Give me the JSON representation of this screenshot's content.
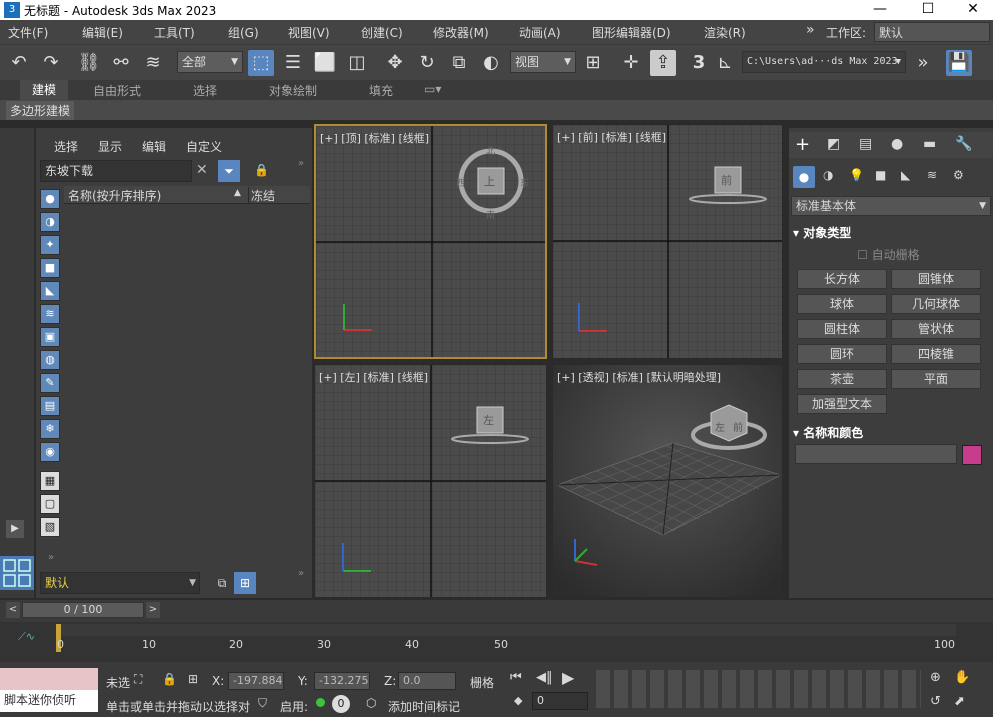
{
  "window": {
    "title": "无标题 - Autodesk 3ds Max 2023",
    "app_icon": "3",
    "minimize": "—",
    "maximize": "☐",
    "close": "✕"
  },
  "menu": [
    "文件(F)",
    "编辑(E)",
    "工具(T)",
    "组(G)",
    "视图(V)",
    "创建(C)",
    "修改器(M)",
    "动画(A)",
    "图形编辑器(D)",
    "渲染(R)"
  ],
  "menu_right": {
    "expand": "»",
    "workspace_label": "工作区:",
    "workspace_value": "默认"
  },
  "toolbar": {
    "selection_filter": "全部",
    "ref_coord": "视图",
    "path": "C:\\Users\\ad···ds Max 2023",
    "snap_value": "3",
    "expand": "»"
  },
  "ribbon": {
    "tabs": [
      "建模",
      "自由形式",
      "选择",
      "对象绘制",
      "填充"
    ],
    "sub_label": "多边形建模"
  },
  "explorer": {
    "menus": [
      "选择",
      "显示",
      "编辑",
      "自定义"
    ],
    "search_value": "东坡下载",
    "col_name": "名称(按升序排序)",
    "col_sort": "▲",
    "col_frozen": "冻结",
    "layer": "默认",
    "expand": "»"
  },
  "viewports": {
    "top": "[+] [顶] [标准] [线框]",
    "front": "[+] [前] [标准] [线框]",
    "left": "[+] [左] [标准] [线框]",
    "persp": "[+] [透视] [标准] [默认明暗处理]",
    "cube_top": "上",
    "cube_front": "前",
    "cube_left": "左",
    "cube_persp_a": "左",
    "cube_persp_b": "前",
    "compass_n": "北",
    "compass_s": "南",
    "compass_w": "西",
    "compass_e": "东"
  },
  "command_panel": {
    "category": "标准基本体",
    "object_type_title": "对象类型",
    "autogrid": "自动栅格",
    "buttons": [
      "长方体",
      "圆锥体",
      "球体",
      "几何球体",
      "圆柱体",
      "管状体",
      "圆环",
      "四棱锥",
      "茶壶",
      "平面",
      "加强型文本"
    ],
    "name_color_title": "名称和颜色",
    "object_color": "#c83c8c"
  },
  "timeline": {
    "frame_display": "0 / 100",
    "ticks": [
      "0",
      "10",
      "20",
      "30",
      "40",
      "50",
      "100"
    ],
    "prev": "<",
    "next": ">"
  },
  "status": {
    "script_listener": "脚本迷你侦听",
    "no_selection": "未选",
    "prompt": "单击或单击并拖动以选择对",
    "x_label": "X:",
    "x_value": "-197.884",
    "y_label": "Y:",
    "y_value": "-132.275",
    "z_label": "Z:",
    "z_value": "0.0",
    "grid": "栅格",
    "enable": "启用:",
    "enable_value": "0",
    "add_time_tag": "添加时间标记",
    "frame_field": "0"
  }
}
